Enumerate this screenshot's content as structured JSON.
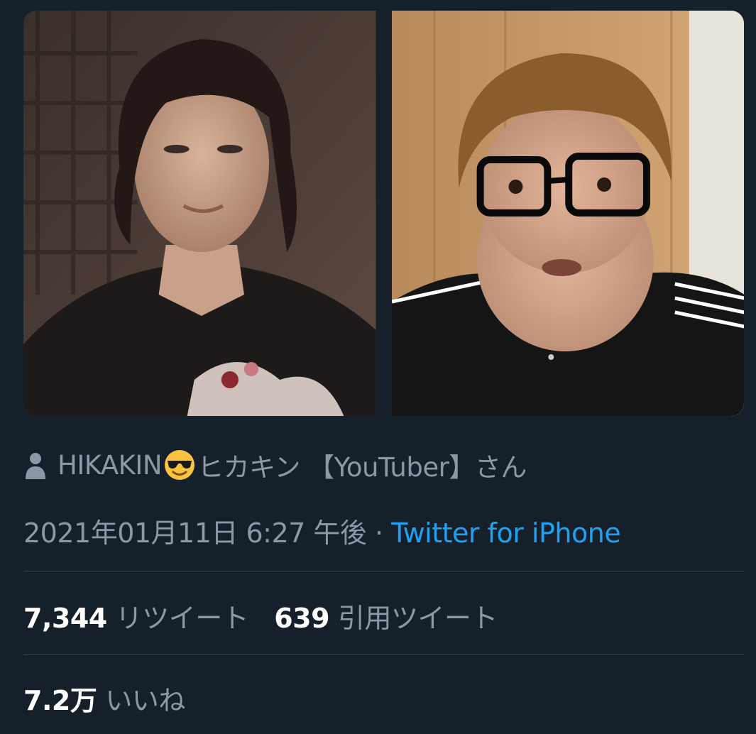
{
  "tweet": {
    "media": [
      {
        "alt_icon": "photo-left-young-man"
      },
      {
        "alt_icon": "photo-right-man-glasses"
      }
    ],
    "attribution": {
      "icon": "person-icon",
      "name_part1": "HIKAKIN",
      "emoji": "smiling-face-with-sunglasses",
      "name_part2": "ヒカキン 【YouTuber】さん"
    },
    "timestamp": "2021年01月11日 6:27 午後",
    "separator": " · ",
    "source": "Twitter for iPhone",
    "retweets": {
      "count": "7,344",
      "label": "リツイート"
    },
    "quote_tweets": {
      "count": "639",
      "label": "引用ツイート"
    },
    "likes": {
      "count": "7.2万",
      "label": "いいね"
    }
  },
  "colors": {
    "background": "#15202b",
    "muted_text": "#8b98a5",
    "link": "#1da1f2",
    "divider": "#38444d"
  }
}
